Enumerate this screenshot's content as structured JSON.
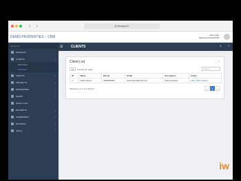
{
  "browser": {
    "url": "jk.thoapp.in"
  },
  "app": {
    "brand": "DEMO PROPERTIES :: CRM",
    "user_line1": "Last Login",
    "user_line2": "2021-04-18 02:05 PM",
    "user_name": "Admin",
    "user_role": "Admin"
  },
  "sidebar": {
    "header": "Navigation",
    "items": [
      {
        "label": "Dashboard"
      },
      {
        "label": "CLIENTS",
        "expanded": true
      },
      {
        "label": "AGENTS"
      },
      {
        "label": "PROJECTS"
      },
      {
        "label": "PROPERTIES"
      },
      {
        "label": "LEADS"
      },
      {
        "label": "Search Lead"
      },
      {
        "label": "PAYMENTS"
      },
      {
        "label": "AGREEMENT"
      },
      {
        "label": "INVOICES"
      },
      {
        "label": "Setting"
      }
    ],
    "subitems": [
      {
        "label": "Add Client"
      },
      {
        "label": "List Client",
        "active": true
      }
    ]
  },
  "topbar": {
    "title": "CLIENTS"
  },
  "card": {
    "title": "Client List",
    "show_count": "10",
    "show_suffix": "records per page",
    "search_placeholder": "Search",
    "columns": [
      "ID",
      "Name",
      "Phone",
      "Email",
      "Occupation",
      "Action"
    ],
    "rows": [
      [
        "1",
        "Client Name",
        "0000000000",
        "Clientname@mail.com",
        "Self employee",
        "View | Edit | Delete"
      ]
    ],
    "info": "Showing 1 to 1 of 1 Entries",
    "pager": [
      "‹",
      "1",
      "›"
    ]
  },
  "logo": "iw",
  "colors": {
    "sidebar": "#2e3e52",
    "accent": "#2f7ed8",
    "brand": "#3b6ea5"
  }
}
